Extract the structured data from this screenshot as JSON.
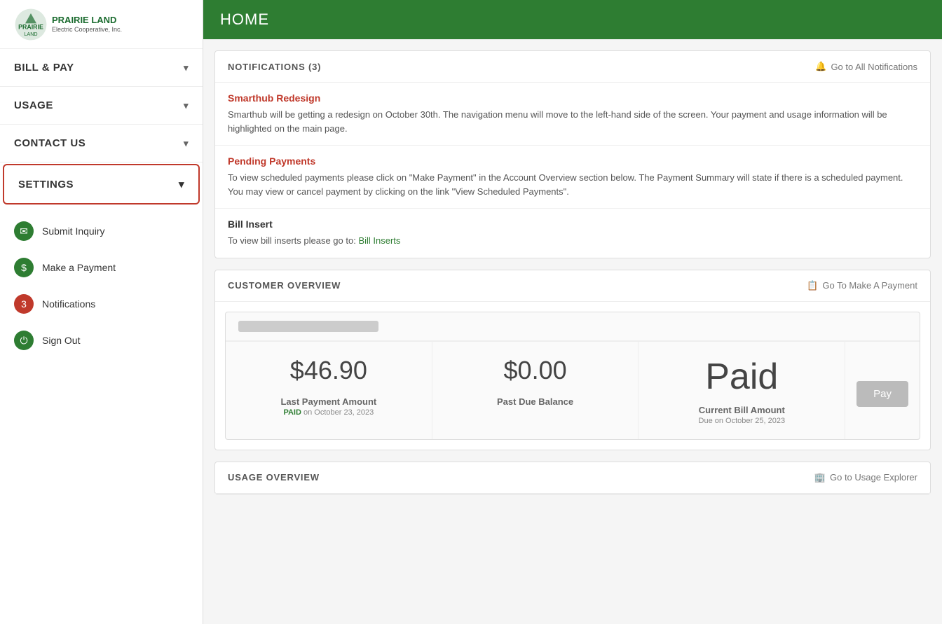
{
  "sidebar": {
    "logo_alt": "Prairie Land Electric Cooperative",
    "nav_items": [
      {
        "id": "bill-pay",
        "label": "BILL & PAY"
      },
      {
        "id": "usage",
        "label": "USAGE"
      },
      {
        "id": "contact-us",
        "label": "CONTACT US"
      },
      {
        "id": "settings",
        "label": "SETTINGS"
      }
    ],
    "quick_links": [
      {
        "id": "submit-inquiry",
        "label": "Submit Inquiry",
        "icon": "email"
      },
      {
        "id": "make-payment",
        "label": "Make a Payment",
        "icon": "payment"
      },
      {
        "id": "notifications",
        "label": "Notifications",
        "icon": "notif",
        "count": 3
      },
      {
        "id": "sign-out",
        "label": "Sign Out",
        "icon": "signout"
      }
    ]
  },
  "header": {
    "title": "HOME"
  },
  "notifications_section": {
    "title": "NOTIFICATIONS (3)",
    "action_label": "Go to All Notifications",
    "items": [
      {
        "id": "smarthub-redesign",
        "title": "Smarthub Redesign",
        "title_type": "red",
        "text": "Smarthub will be getting a redesign on October 30th. The navigation menu will move to the left-hand side of the screen. Your payment and usage information will be highlighted on the main page."
      },
      {
        "id": "pending-payments",
        "title": "Pending Payments",
        "title_type": "red",
        "text": "To view scheduled payments please click on \"Make Payment\" in the Account Overview section below. The Payment Summary will state if there is a scheduled payment. You may view or cancel payment by clicking on the link \"View Scheduled Payments\"."
      },
      {
        "id": "bill-insert",
        "title": "Bill Insert",
        "title_type": "plain",
        "text_prefix": "To view bill inserts please go to: ",
        "link_text": "Bill Inserts",
        "link_id": "bill-inserts-link"
      }
    ]
  },
  "customer_overview": {
    "section_title": "CUSTOMER OVERVIEW",
    "action_label": "Go To Make A Payment",
    "last_payment_amount": "$46.90",
    "last_payment_label": "Last Payment Amount",
    "last_payment_status": "PAID",
    "last_payment_date": "on October 23, 2023",
    "past_due_amount": "$0.00",
    "past_due_label": "Past Due Balance",
    "current_bill_status": "Paid",
    "current_bill_label": "Current Bill Amount",
    "current_bill_due": "Due on October 25, 2023",
    "pay_button_label": "Pay"
  },
  "usage_overview": {
    "section_title": "USAGE OVERVIEW",
    "action_label": "Go to Usage Explorer"
  },
  "icons": {
    "bell": "🔔",
    "clipboard": "📋",
    "building": "🏢",
    "chevron_down": "▾"
  }
}
